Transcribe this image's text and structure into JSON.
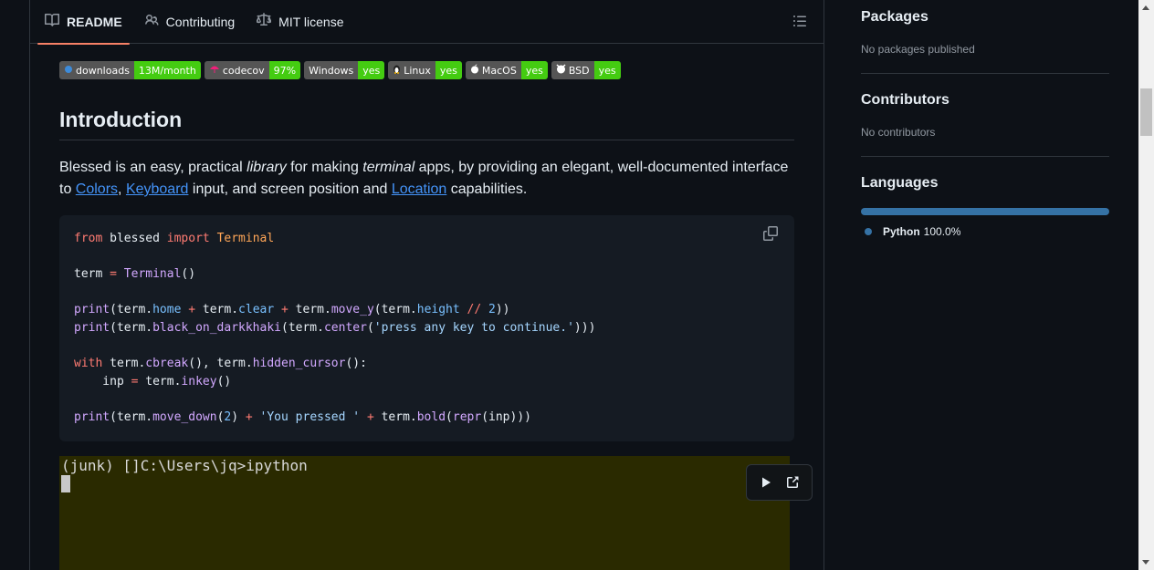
{
  "tabs": [
    {
      "label": "README",
      "icon": "book-icon",
      "active": true
    },
    {
      "label": "Contributing",
      "icon": "people-icon"
    },
    {
      "label": "MIT license",
      "icon": "law-icon"
    }
  ],
  "badges": [
    {
      "left": "downloads",
      "right": "13M/month",
      "icon": "pepy-icon"
    },
    {
      "left": "codecov",
      "right": "97%",
      "icon": "umbrella-icon"
    },
    {
      "left": "Windows",
      "right": "yes"
    },
    {
      "left": "Linux",
      "right": "yes",
      "icon": "tux-icon"
    },
    {
      "left": "MacOS",
      "right": "yes",
      "icon": "apple-icon"
    },
    {
      "left": "BSD",
      "right": "yes",
      "icon": "bsd-icon"
    }
  ],
  "intro": {
    "heading": "Introduction",
    "p1": "Blessed is an easy, practical ",
    "library": "library",
    "p2": " for making ",
    "terminal": "terminal",
    "p3": " apps, by providing an elegant, well-documented interface to ",
    "colors": "Colors",
    "comma": ",",
    "keyboard": "Keyboard",
    "p4": " input, and screen position and ",
    "location": "Location",
    "p5": " capabilities."
  },
  "terminal": {
    "line1": "(junk) []C:\\Users\\jq>ipython"
  },
  "sidebar": {
    "packages": {
      "heading": "Packages",
      "text": "No packages published"
    },
    "contributors": {
      "heading": "Contributors",
      "text": "No contributors"
    },
    "languages": {
      "heading": "Languages",
      "name": "Python",
      "percent": "100.0%",
      "share": 1.0,
      "color": "#3572A5"
    }
  },
  "colors": {
    "accent": "#f78166",
    "link": "#4493f8",
    "badge_green": "#44cc11"
  }
}
